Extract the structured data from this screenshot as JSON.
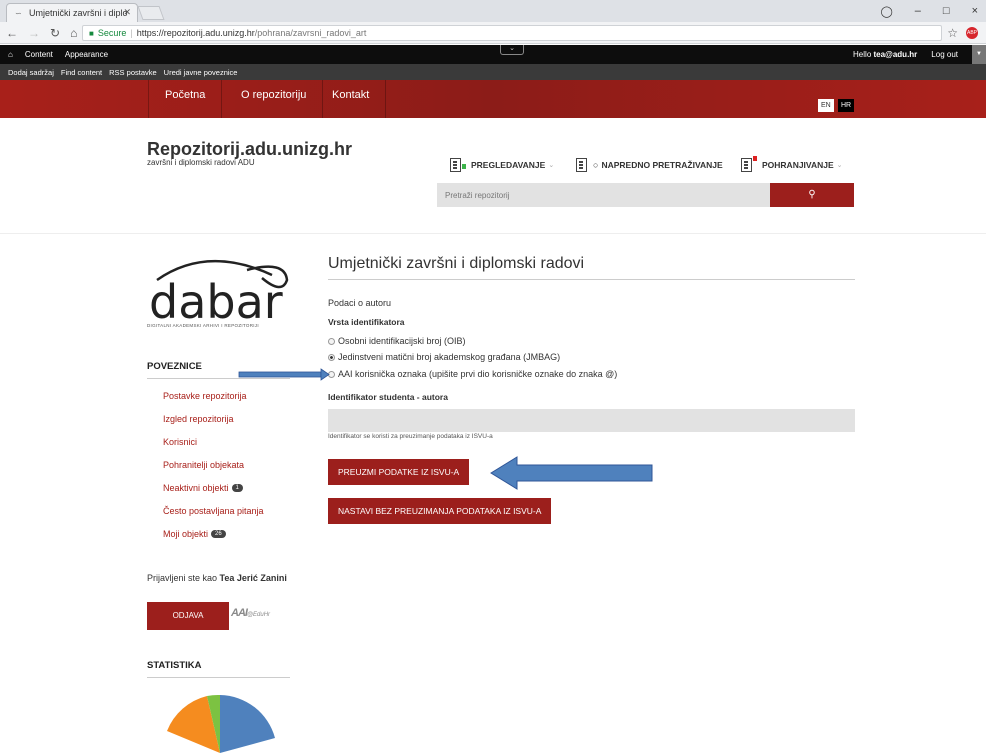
{
  "browser": {
    "tab_title": "Umjetnički završni i diplo",
    "secure_label": "Secure",
    "url_host": "https://repozitorij.adu.unizg.hr",
    "url_path": "/pohrana/zavrsni_radovi_art",
    "win_min": "–",
    "win_max": "□",
    "win_close": "×"
  },
  "admin_bar": {
    "items": [
      "Content",
      "Appearance"
    ],
    "hello_prefix": "Hello ",
    "user": "tea@adu.hr",
    "logout": "Log out"
  },
  "shortcuts": [
    "Dodaj sadržaj",
    "Find content",
    "RSS postavke",
    "Uredi javne poveznice"
  ],
  "site_nav": {
    "items": [
      "Početna",
      "O repozitoriju",
      "Kontakt"
    ],
    "lang_en": "EN",
    "lang_hr": "HR"
  },
  "header": {
    "title": "Repozitorij.adu.unizg.hr",
    "subtitle": "završni i diplomski radovi ADU",
    "menu": [
      "PREGLEDAVANJE",
      "NAPREDNO PRETRAŽIVANJE",
      "POHRANJIVANJE"
    ],
    "search_placeholder": "Pretraži repozitorij"
  },
  "sidebar": {
    "logo_text": "dabar",
    "logo_caption": "DIGITALNI AKADEMSKI ARHIVI I REPOZITORIJI",
    "links_heading": "POVEZNICE",
    "links": [
      {
        "label": "Postavke repozitorija"
      },
      {
        "label": "Izgled repozitorija"
      },
      {
        "label": "Korisnici"
      },
      {
        "label": "Pohranitelji objekata"
      },
      {
        "label": "Neaktivni objekti",
        "badge": "1"
      },
      {
        "label": "Često postavljana pitanja"
      },
      {
        "label": "Moji objekti",
        "badge": "26"
      }
    ],
    "logged_in_prefix": "Prijavljeni ste kao ",
    "logged_in_user": "Tea Jerić Zanini",
    "logout_button": "ODJAVA",
    "aai_logo": "AAI",
    "aai_suffix": "@EduHr",
    "stats_heading": "STATISTIKA"
  },
  "main": {
    "page_title": "Umjetnički završni i diplomski radovi",
    "section_label": "Podaci o autoru",
    "id_type_label": "Vrsta identifikatora",
    "radio_options": [
      "Osobni identifikacijski broj (OIB)",
      "Jedinstveni matični broj akademskog građana (JMBAG)",
      "AAI korisnička oznaka (upišite prvi dio korisničke oznake do znaka @)"
    ],
    "selected_option": 1,
    "student_id_label": "Identifikator studenta - autora",
    "student_id_value": "",
    "help_text": "Identifikator se koristi za preuzimanje podataka iz ISVU-a",
    "btn_fetch": "PREUZMI PODATKE IZ ISVU-A",
    "btn_continue": "NASTAVI BEZ PREUZIMANJA PODATAKA IZ ISVU-A"
  },
  "colors": {
    "brand_red": "#9c1f1c",
    "link_red": "#a8201a",
    "annotation_blue": "#4f81bd",
    "pie": [
      "#4f81bd",
      "#f58c1f",
      "#7cc242"
    ]
  },
  "icons": [
    "close-icon",
    "back-icon",
    "forward-icon",
    "reload-icon",
    "home-icon",
    "lock-icon",
    "star-icon",
    "search-icon",
    "browse-doc-icon",
    "advanced-search-doc-icon",
    "deposit-doc-icon",
    "chevron-down-icon"
  ]
}
